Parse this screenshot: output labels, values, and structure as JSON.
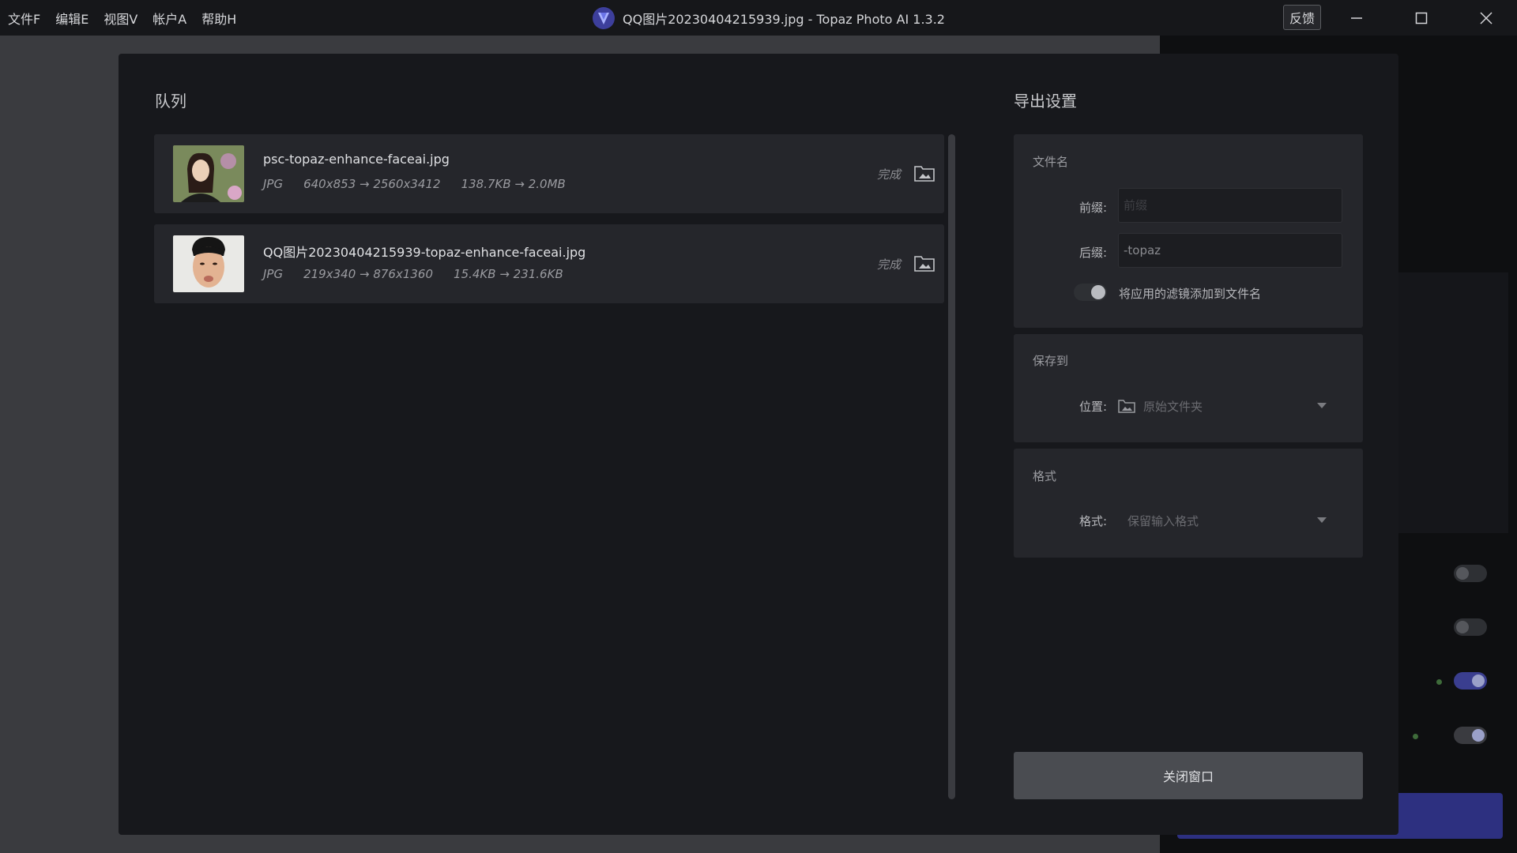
{
  "menu": {
    "items": [
      "文件F",
      "编辑E",
      "视图V",
      "帐户A",
      "帮助H"
    ]
  },
  "window": {
    "title": "QQ图片20230404215939.jpg - Topaz Photo AI 1.3.2",
    "feedback_label": "反馈",
    "icons": [
      "minimize-icon",
      "maximize-icon",
      "close-icon"
    ]
  },
  "queue": {
    "title": "队列",
    "items": [
      {
        "filename": "psc-topaz-enhance-faceai.jpg",
        "format": "JPG",
        "dimensions": "640x853 → 2560x3412",
        "size": "138.7KB → 2.0MB",
        "status": "完成"
      },
      {
        "filename": "QQ图片20230404215939-topaz-enhance-faceai.jpg",
        "format": "JPG",
        "dimensions": "219x340 → 876x1360",
        "size": "15.4KB → 231.6KB",
        "status": "完成"
      }
    ]
  },
  "export": {
    "title": "导出设置",
    "filename": {
      "label": "文件名",
      "prefix_label": "前缀:",
      "prefix_value": "",
      "prefix_placeholder": "前缀",
      "suffix_label": "后缀:",
      "suffix_value": "-topaz",
      "toggle_label": "将应用的滤镜添加到文件名",
      "toggle_on": true
    },
    "save_to": {
      "label": "保存到",
      "location_label": "位置:",
      "location_value": "原始文件夹"
    },
    "format": {
      "label": "格式",
      "format_label": "格式:",
      "format_value": "保留输入格式"
    },
    "close_label": "关闭窗口"
  },
  "colors": {
    "accent": "#3a3e8f",
    "modal_bg": "#17181c",
    "card_bg": "#25262b"
  }
}
